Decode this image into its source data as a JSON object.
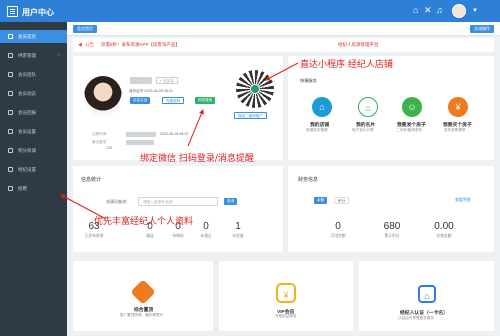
{
  "header": {
    "title": "用户中心"
  },
  "sidebar": {
    "items": [
      {
        "label": "会员首页"
      },
      {
        "label": "供客管理"
      },
      {
        "label": "会员团队"
      },
      {
        "label": "会员动态"
      },
      {
        "label": "会员回报"
      },
      {
        "label": "会员设置"
      },
      {
        "label": "积分商城"
      },
      {
        "label": "经纪设置"
      },
      {
        "label": "招聘"
      }
    ]
  },
  "tabs": {
    "home": "会员首页",
    "right": "关闭操作"
  },
  "notice": {
    "label": "公告",
    "text": "仅需8秒！发布房源APP【房客淘产品】",
    "text2": "经纪人房源管理平台"
  },
  "profile": {
    "verify_badge": "+ 未实名",
    "btn1": "实名认证",
    "btn2": "完善资料",
    "btn3": "绑定微信",
    "line1": "身份证号 2023-06-28 08:22",
    "line2": "手机号",
    "reg": "注册时间",
    "last": "最近登录",
    "date1": "2023-06-28 08:22",
    "date2": "133",
    "qr_btn": "保存二维码推广"
  },
  "services": {
    "title": "快捷服务",
    "items": [
      {
        "label": "我的店铺",
        "sub": "房源发布管理",
        "color": "#1c9bd6",
        "icon": "⌂"
      },
      {
        "label": "我的名片",
        "sub": "电子名片分享",
        "color": "#2db36a",
        "icon": "⌂"
      },
      {
        "label": "我要发个房子",
        "sub": "二手房/租房发布",
        "color": "#3bb34a",
        "icon": "☺"
      },
      {
        "label": "我要买个房子",
        "sub": "发布求购需求",
        "color": "#f07a1e",
        "icon": "¥"
      }
    ]
  },
  "stats": {
    "title": "信息统计",
    "keyword_label": "关键词查询：",
    "keyword_placeholder": "请输入房源号/名称",
    "search_btn": "查询",
    "items": [
      {
        "num": "63",
        "lbl": "已发布房源"
      },
      {
        "num": "0",
        "lbl": "精选"
      },
      {
        "num": "0",
        "lbl": "待审核"
      },
      {
        "num": "0",
        "lbl": "未通过"
      },
      {
        "num": "1",
        "lbl": "浏览量"
      }
    ]
  },
  "finance": {
    "title": "财务信息",
    "tab1": "余额",
    "tab2": "积分",
    "link": "查看明细",
    "items": [
      {
        "num": "0",
        "lbl": "可用余额"
      },
      {
        "num": "680",
        "lbl": "累计积分"
      },
      {
        "num": "0.00",
        "lbl": "冻结金额"
      }
    ]
  },
  "bottom": [
    {
      "label": "综合置顶",
      "sub": "推广置顶房源，曝光率提升",
      "color": "#f07a1e"
    },
    {
      "label": "VIP会员",
      "sub": "专属权益服务",
      "color": "#f2b21c"
    },
    {
      "label": "经纪人认证（一卡名）",
      "sub": "认证后可享受更多服务",
      "color": "#2e7fd6"
    }
  ],
  "annotations": {
    "a1": "直达小程序 经纪人店铺",
    "a2": "绑定微信 扫码登录/消息提醒",
    "a3": "优先丰富经纪人个人资料"
  },
  "colors": {
    "primary": "#2e7fd6",
    "sidebar": "#2f3a44",
    "annotation": "#e0201b"
  }
}
